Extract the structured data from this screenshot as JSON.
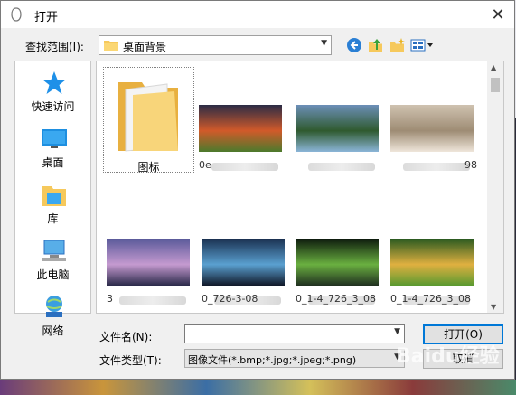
{
  "dialog": {
    "title": "打开",
    "close_glyph": "✕"
  },
  "lookin": {
    "label": "查找范围(I):",
    "value": "桌面背景"
  },
  "toolbar": {
    "back_icon": "back-icon",
    "up_icon": "up-folder-icon",
    "new_folder_icon": "new-folder-icon",
    "view_menu_icon": "view-menu-icon"
  },
  "places": [
    {
      "label": "快速访问",
      "icon": "star-icon"
    },
    {
      "label": "桌面",
      "icon": "desktop-icon"
    },
    {
      "label": "库",
      "icon": "library-icon"
    },
    {
      "label": "此电脑",
      "icon": "computer-icon"
    },
    {
      "label": "网络",
      "icon": "network-icon"
    }
  ],
  "files": {
    "folder": {
      "label": "图标"
    },
    "thumbs": [
      {
        "caption": "0e",
        "colors": [
          "#2b2b45",
          "#d15a2a",
          "#4c7a2c"
        ]
      },
      {
        "caption": "",
        "colors": [
          "#6c8fb8",
          "#2f5a2f",
          "#8bb5d8"
        ]
      },
      {
        "caption": "98",
        "colors": [
          "#cfc2b0",
          "#9e8c74",
          "#efe6da"
        ]
      },
      {
        "caption": "3",
        "colors": [
          "#5a5a9a",
          "#c59ad0",
          "#2a2a4a"
        ]
      },
      {
        "caption": "0_726-3-08",
        "colors": [
          "#1a3050",
          "#5aa0d0",
          "#101828"
        ]
      },
      {
        "caption": "0_1-4_726_3_08",
        "colors": [
          "#0d1a0d",
          "#6ab040",
          "#203020"
        ]
      },
      {
        "caption": "0_1-4_726_3_08",
        "colors": [
          "#2a5a20",
          "#e0b040",
          "#5a9a30"
        ]
      }
    ]
  },
  "filename": {
    "label": "文件名(N):",
    "value": ""
  },
  "filetype": {
    "label": "文件类型(T):",
    "value": "图像文件(*.bmp;*.jpg;*.jpeg;*.png)"
  },
  "buttons": {
    "open": "打开(O)",
    "cancel": "取消"
  },
  "watermark": "Baidu经验"
}
